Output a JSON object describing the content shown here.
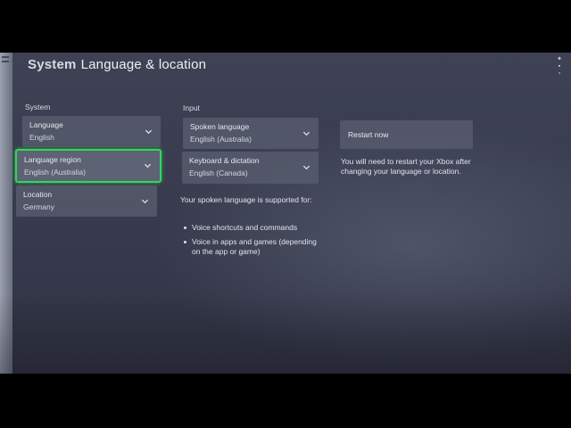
{
  "header": {
    "brand": "System",
    "title": "Language & location"
  },
  "system": {
    "section_label": "System",
    "language": {
      "label": "Language",
      "value": "English"
    },
    "language_region": {
      "label": "Language region",
      "value": "English (Australia)"
    },
    "location": {
      "label": "Location",
      "value": "Germany"
    }
  },
  "input": {
    "section_label": "Input",
    "spoken_language": {
      "label": "Spoken language",
      "value": "English (Australia)"
    },
    "keyboard": {
      "label": "Keyboard & dictation",
      "value": "English (Canada)"
    },
    "support_text": "Your spoken language is supported for:",
    "support_items": [
      "Voice shortcuts and commands",
      "Voice in apps and games (depending on the app or game)"
    ]
  },
  "restart": {
    "button_label": "Restart now",
    "note": "You will need to restart your Xbox after changing your language or location."
  },
  "icons": {
    "dropdown": "chevron-down-icon"
  },
  "colors": {
    "focus_ring": "#2fd85a",
    "panel": "#565a6c",
    "background": "#3a3d50"
  }
}
